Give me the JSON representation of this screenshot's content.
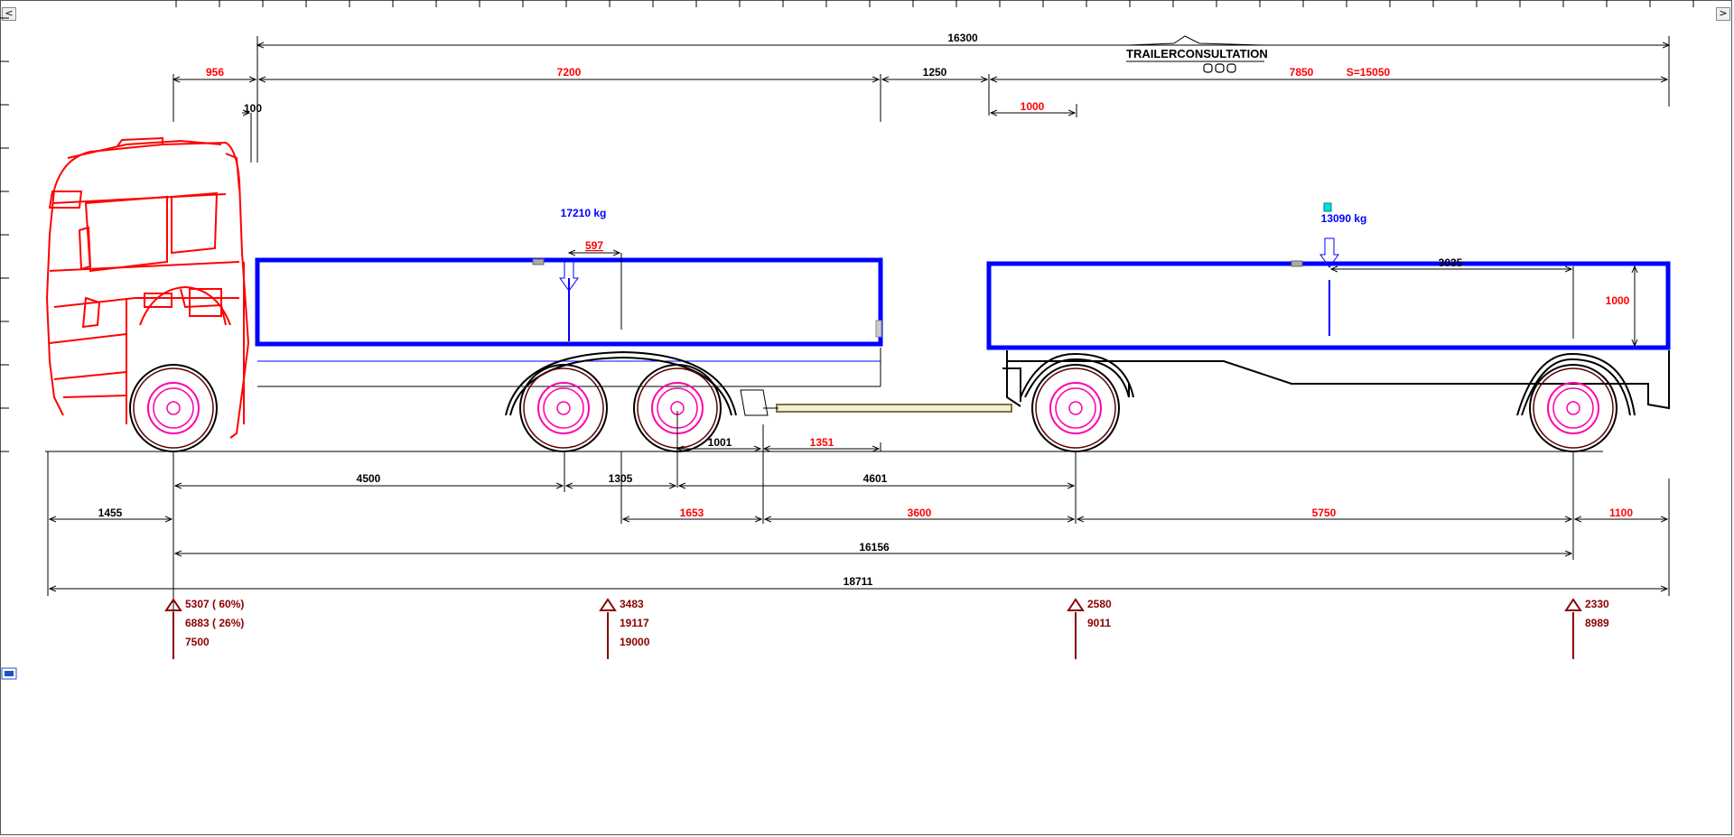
{
  "nav": {
    "left": "<",
    "right": ">"
  },
  "logo": {
    "text": "TRAILERCONSULTATION",
    "icon": "ooo-logo-icon"
  },
  "colors": {
    "black": "#000000",
    "red": "#ff0000",
    "blue": "#0000ff",
    "loads": "#8b0000",
    "magenta": "#ff00aa"
  },
  "top_dims": {
    "total": "16300",
    "truck_front": "956",
    "truck_body": "7200",
    "gap": "1250",
    "trailer_body": "7850",
    "trailer_s": "S=15050",
    "cab_gap": "100",
    "trailer_front_offset": "1000"
  },
  "payloads": {
    "truck": "17210 kg",
    "trailer": "13090 kg"
  },
  "body_dims": {
    "truck_cog": "597",
    "trailer_cog": "3035",
    "trailer_height": "1000"
  },
  "bottom_dims": {
    "hitch_1": "1001",
    "hitch_2": "1351",
    "wb_1": "4500",
    "wb_2": "1305",
    "drawbar": "4601",
    "front_overhang": "1455",
    "r_1653": "1653",
    "r_3600": "3600",
    "r_5750": "5750",
    "r_1100": "1100",
    "axle_span": "16156",
    "overall_length": "18711"
  },
  "axle_loads": [
    {
      "lines": [
        "5307 ( 60%)",
        "6883 ( 26%)",
        "7500"
      ]
    },
    {
      "lines": [
        "3483",
        "19117",
        "19000"
      ]
    },
    {
      "lines": [
        "2580",
        "9011"
      ]
    },
    {
      "lines": [
        "2330",
        "8989"
      ]
    }
  ]
}
